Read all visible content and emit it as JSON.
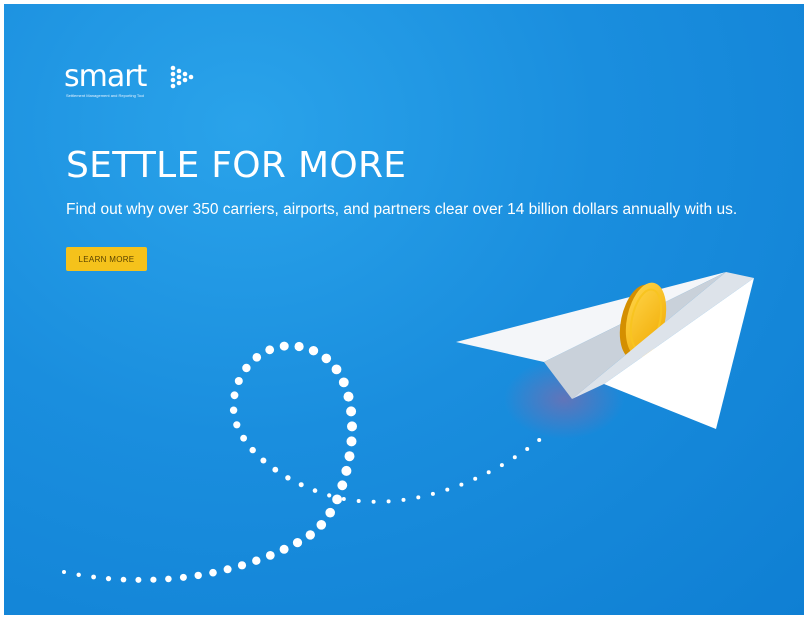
{
  "brand": {
    "name": "smart",
    "tagline": "Settlement Management and Reporting Tool",
    "logo_icon": "dotted-arrow-icon"
  },
  "hero": {
    "headline": "SETTLE FOR MORE",
    "subhead": "Find out why over 350 carriers, airports, and partners clear over 14 billion dollars annually with us.",
    "cta_label": "LEARN MORE",
    "illustration": "paper-plane-with-gold-coin"
  },
  "colors": {
    "background": "#1a8ede",
    "cta": "#f5c21b",
    "text": "#ffffff",
    "coin": "#f5b800"
  }
}
